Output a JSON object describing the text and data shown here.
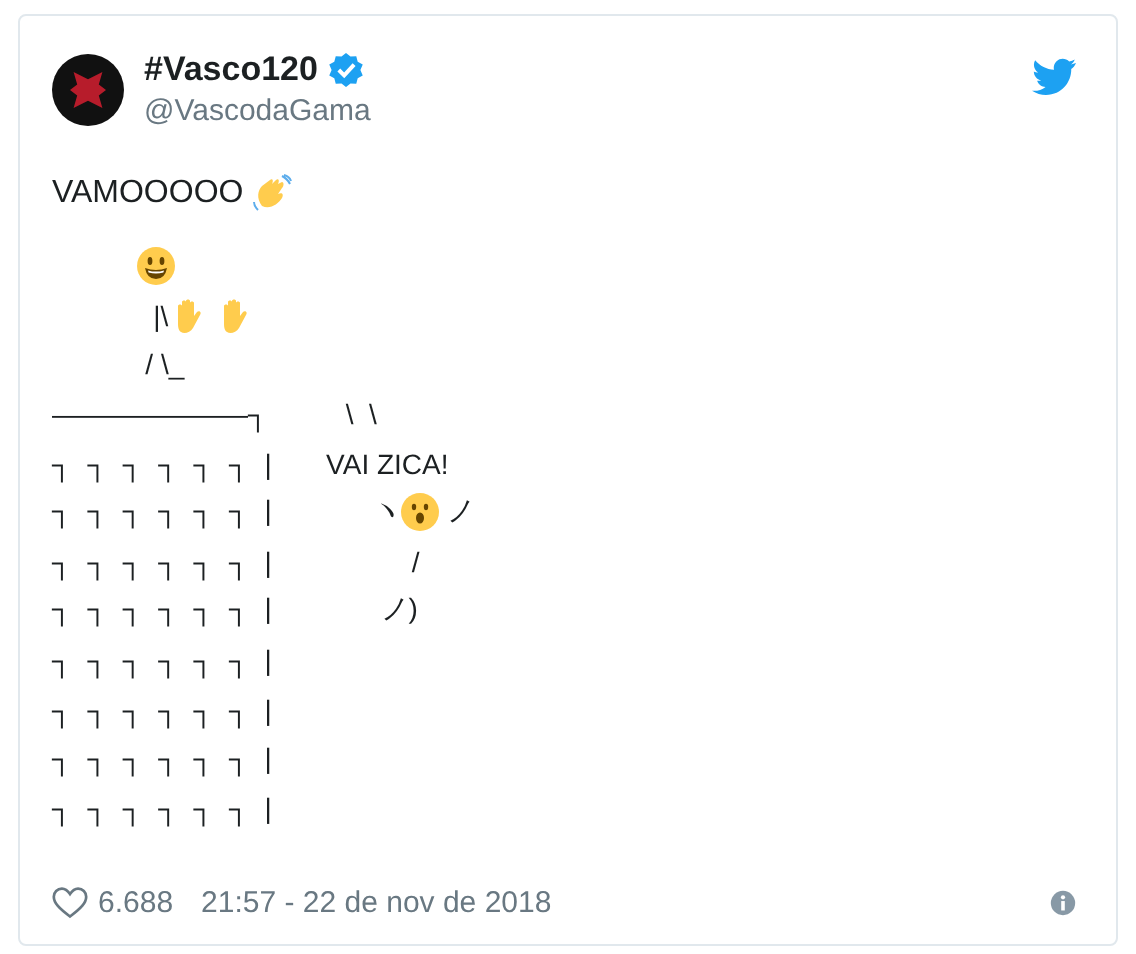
{
  "author": {
    "name": "#Vasco120",
    "verified": true,
    "handle": "@VascodaGama"
  },
  "message": [
    {
      "kind": "text",
      "text": "VAMOOOOO "
    },
    {
      "kind": "wave"
    }
  ],
  "art_lines": [
    [
      {
        "kind": "smiley"
      }
    ],
    [
      {
        "kind": "text",
        "text": "             |\\"
      },
      {
        "kind": "hand"
      },
      {
        "kind": "hand"
      }
    ],
    [
      {
        "kind": "text",
        "text": "            / \\_"
      }
    ],
    [
      {
        "kind": "text",
        "text": "———————┐          \\  \\"
      }
    ],
    [
      {
        "kind": "text",
        "text": "┐  ┐  ┐  ┐  ┐  ┐  |       VAI ZICA!"
      }
    ],
    [
      {
        "kind": "text",
        "text": "┐  ┐  ┐  ┐  ┐  ┐  |             ヽ"
      },
      {
        "kind": "surprised"
      },
      {
        "kind": "text",
        "text": "ノ"
      }
    ],
    [
      {
        "kind": "text",
        "text": "┐  ┐  ┐  ┐  ┐  ┐  |                  /"
      }
    ],
    [
      {
        "kind": "text",
        "text": "┐  ┐  ┐  ┐  ┐  ┐  |              ノ)"
      }
    ],
    [
      {
        "kind": "text",
        "text": "┐  ┐  ┐  ┐  ┐  ┐  |"
      }
    ],
    [
      {
        "kind": "text",
        "text": "┐  ┐  ┐  ┐  ┐  ┐  |"
      }
    ],
    [
      {
        "kind": "text",
        "text": "┐  ┐  ┐  ┐  ┐  ┐  |"
      }
    ],
    [
      {
        "kind": "text",
        "text": "┐  ┐  ┐  ┐  ┐  ┐  |"
      }
    ]
  ],
  "likes": "6.688",
  "timestamp": "21:57 - 22 de nov de 2018"
}
